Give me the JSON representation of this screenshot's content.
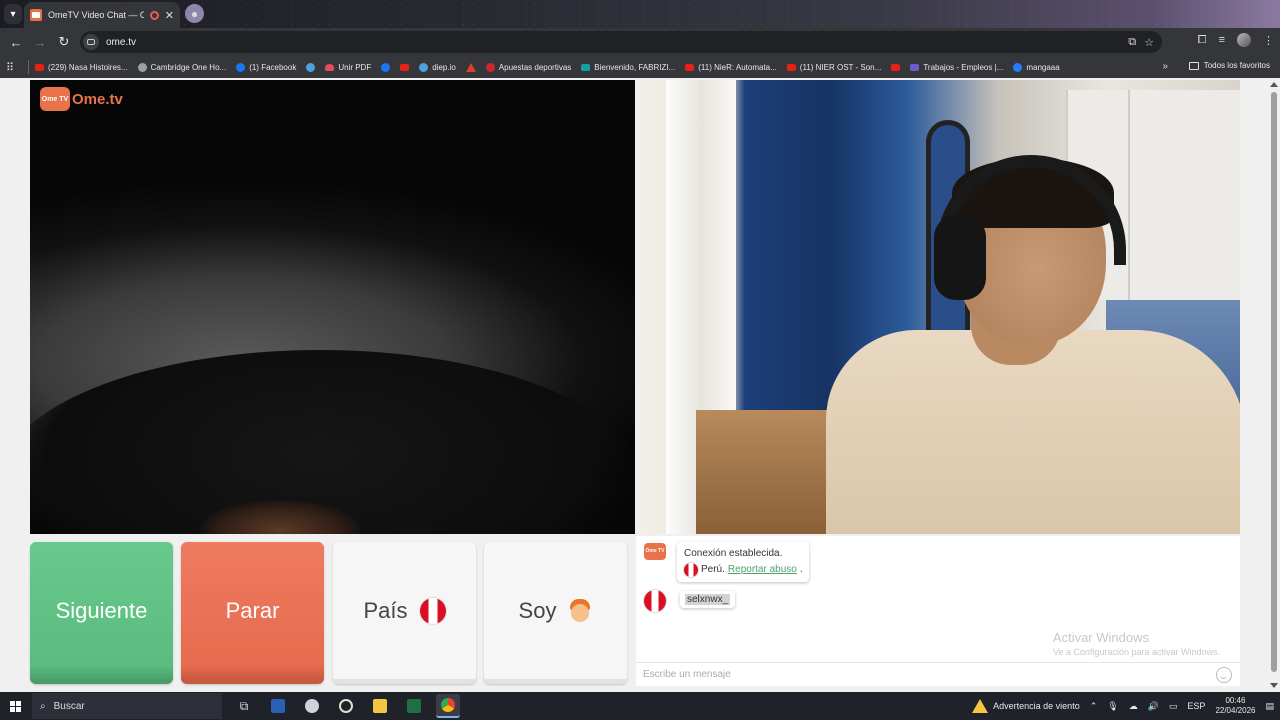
{
  "browser": {
    "tab_title": "OmeTV Video Chat — Ome",
    "url": "ome.tv",
    "bookmarks": [
      {
        "label": "(229) Nasa Histoires...",
        "icon": "yt"
      },
      {
        "label": "Cambridge One Ho...",
        "icon": "grey"
      },
      {
        "label": "(1) Facebook",
        "icon": "fb"
      },
      {
        "label": "",
        "icon": "blue"
      },
      {
        "label": "Unir PDF",
        "icon": "heart"
      },
      {
        "label": "",
        "icon": "fb"
      },
      {
        "label": "",
        "icon": "yt"
      },
      {
        "label": "diep.io",
        "icon": "blue"
      },
      {
        "label": "",
        "icon": "tri"
      },
      {
        "label": "Apuestas deportivas",
        "icon": "redc"
      },
      {
        "label": "Bienvenido, FABRIZI...",
        "icon": "teal"
      },
      {
        "label": "(11) NieR: Automata...",
        "icon": "yt"
      },
      {
        "label": "(11) NIER OST - Son...",
        "icon": "yt"
      },
      {
        "label": "",
        "icon": "yt"
      },
      {
        "label": "Trabajos - Empleos |...",
        "icon": "purple"
      },
      {
        "label": "mangaaa",
        "icon": "bluec"
      }
    ],
    "all_bookmarks": "Todos los favoritos"
  },
  "logo": {
    "tv": "Ome TV",
    "text": "Ome.tv"
  },
  "buttons": {
    "next": "Siguiente",
    "stop": "Parar",
    "country": "País",
    "gender": "Soy"
  },
  "chat": {
    "logo": "Ome TV",
    "system_line1": "Conexión establecida.",
    "system_country": "Perú.",
    "report_link": "Reportar abuso",
    "report_suffix": ".",
    "user_message": "selxnwx_",
    "watermark_title": "Activar Windows",
    "watermark_sub": "Ve a Configuración para activar Windows.",
    "input_placeholder": "Escribe un mensaje"
  },
  "taskbar": {
    "search": "Buscar",
    "weather_alert": "Advertencia de viento",
    "lang": "ESP",
    "time": "00:46",
    "date": "22/04/2026"
  },
  "colors": {
    "next": "#5bbc80",
    "stop": "#e66b4f",
    "brand": "#e8734a"
  }
}
